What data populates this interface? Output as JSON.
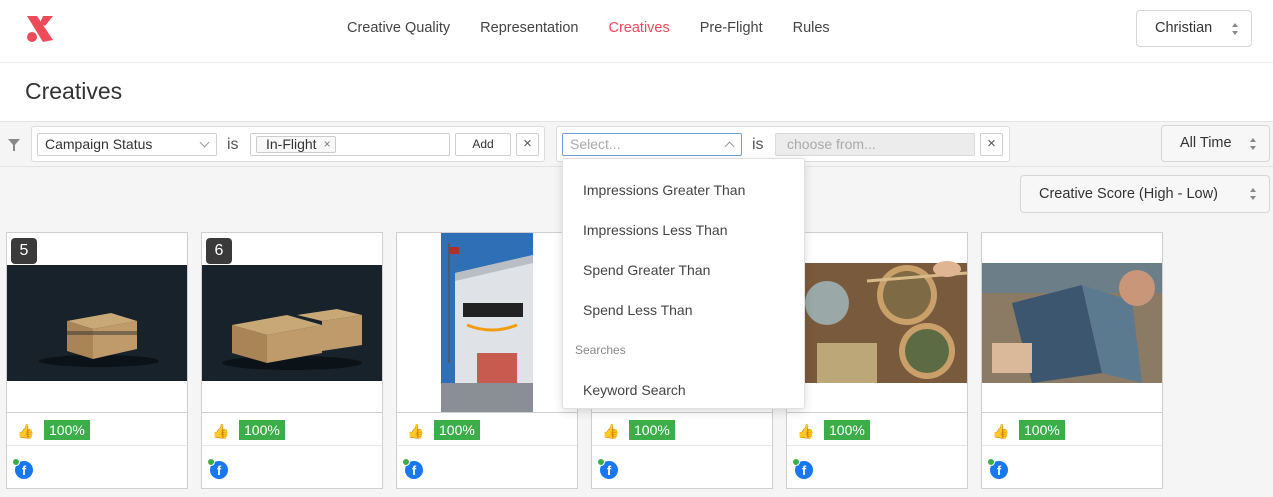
{
  "nav": {
    "items": [
      {
        "label": "Creative Quality",
        "active": false
      },
      {
        "label": "Representation",
        "active": false
      },
      {
        "label": "Creatives",
        "active": true
      },
      {
        "label": "Pre-Flight",
        "active": false
      },
      {
        "label": "Rules",
        "active": false
      }
    ],
    "user": "Christian",
    "accent": "#ee4a58"
  },
  "page": {
    "title": "Creatives"
  },
  "filters": {
    "filter1": {
      "field": "Campaign Status",
      "op": "is",
      "value_tag": "In-Flight",
      "remove_tag": "×",
      "add_label": "Add",
      "remove_label": "×"
    },
    "filter2": {
      "field_placeholder": "Select...",
      "op": "is",
      "value_placeholder": "choose from...",
      "remove_label": "×"
    },
    "time_range": "All Time",
    "sort": "Creative Score (High - Low)"
  },
  "dropdown": {
    "items": [
      "Impressions Greater Than",
      "Impressions Less Than",
      "Spend Greater Than",
      "Spend Less Than"
    ],
    "group_label": "Searches",
    "group_items": [
      "Keyword Search"
    ]
  },
  "cards": [
    {
      "rank": "5",
      "score": "100%",
      "platform": "facebook-icon",
      "image": "amazon-boxes-dark"
    },
    {
      "rank": "6",
      "score": "100%",
      "platform": "facebook-icon",
      "image": "amazon-boxes-dark-2"
    },
    {
      "rank": "",
      "score": "100%",
      "platform": "facebook-icon",
      "image": "amazon-warehouse"
    },
    {
      "rank": "",
      "score": "100%",
      "platform": "facebook-icon",
      "image": "hidden"
    },
    {
      "rank": "",
      "score": "100%",
      "platform": "facebook-icon",
      "image": "dumplings-table"
    },
    {
      "rank": "",
      "score": "100%",
      "platform": "facebook-icon",
      "image": "person-reading-magazine"
    }
  ],
  "colors": {
    "score_green": "#3bae4a",
    "facebook_blue": "#1877f2"
  }
}
